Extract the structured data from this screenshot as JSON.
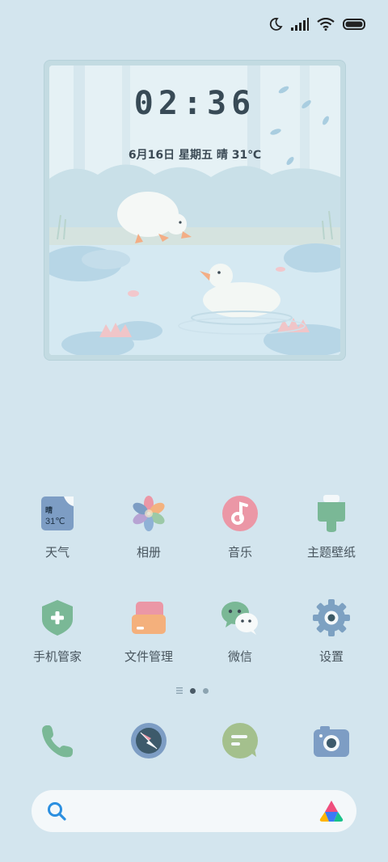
{
  "clock": {
    "time": "02:36",
    "date": "6月16日  星期五  晴  31℃"
  },
  "apps_row1": [
    {
      "label": "天气",
      "icon": "weather-icon",
      "icon_text_top": "晴",
      "icon_text_bottom": "31℃"
    },
    {
      "label": "相册",
      "icon": "gallery-icon"
    },
    {
      "label": "音乐",
      "icon": "music-icon"
    },
    {
      "label": "主题壁纸",
      "icon": "theme-icon"
    }
  ],
  "apps_row2": [
    {
      "label": "手机管家",
      "icon": "security-shield-icon"
    },
    {
      "label": "文件管理",
      "icon": "folder-icon"
    },
    {
      "label": "微信",
      "icon": "wechat-icon"
    },
    {
      "label": "设置",
      "icon": "gear-icon"
    }
  ],
  "pager": {
    "pages": 2,
    "current": 1
  },
  "dock": [
    {
      "icon": "phone-icon"
    },
    {
      "icon": "browser-compass-icon"
    },
    {
      "icon": "messages-icon"
    },
    {
      "icon": "camera-icon"
    }
  ],
  "colors": {
    "background": "#d3e5ee",
    "accent_green": "#7ab896",
    "accent_pink": "#eb97a6",
    "accent_blue": "#7d9dc4"
  }
}
